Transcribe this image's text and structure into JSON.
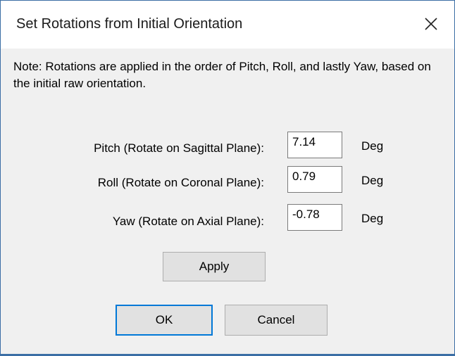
{
  "dialog": {
    "title": "Set Rotations from Initial Orientation",
    "close_glyph": "✕"
  },
  "note": {
    "text": "Note: Rotations are applied in the order of Pitch, Roll, and lastly Yaw, based on the initial raw orientation."
  },
  "rows": [
    {
      "label": "Pitch (Rotate on Sagittal Plane):",
      "value": "7.14",
      "unit": "Deg"
    },
    {
      "label": "Roll (Rotate on Coronal Plane):",
      "value": "0.79",
      "unit": "Deg"
    },
    {
      "label": "Yaw (Rotate on Axial Plane):",
      "value": "-0.78",
      "unit": "Deg"
    }
  ],
  "buttons": {
    "apply": "Apply",
    "ok": "OK",
    "cancel": "Cancel"
  }
}
